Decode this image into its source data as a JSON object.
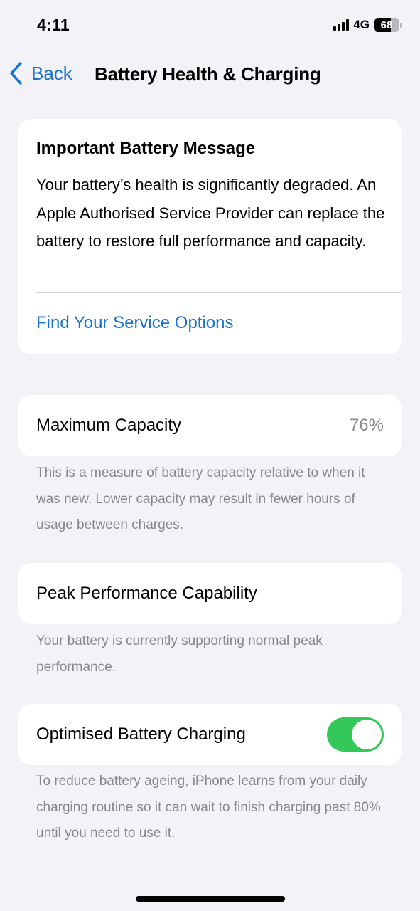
{
  "status_bar": {
    "time": "4:11",
    "network": "4G",
    "signal_bars": 4,
    "battery_level": "68",
    "battery_fraction": 0.68
  },
  "nav": {
    "back_label": "Back",
    "title": "Battery Health & Charging"
  },
  "battery_message": {
    "title": "Important Battery Message",
    "body": "Your battery’s health is significantly degraded. An Apple Authorised Service Provider can replace the battery to restore full performance and capacity.",
    "link": "Find Your Service Options"
  },
  "maximum_capacity": {
    "label": "Maximum Capacity",
    "value": "76%",
    "footnote": "This is a measure of battery capacity relative to when it was new. Lower capacity may result in fewer hours of usage between charges."
  },
  "peak_performance": {
    "label": "Peak Performance Capability",
    "footnote": "Your battery is currently supporting normal peak performance."
  },
  "optimised_charging": {
    "label": "Optimised Battery Charging",
    "enabled": true,
    "footnote": "To reduce battery ageing, iPhone learns from your daily charging routine so it can wait to finish charging past 80% until you need to use it."
  },
  "colors": {
    "accent": "#1a73d1",
    "toggle_on": "#34c759",
    "background": "#f2f2f7",
    "secondary_text": "#86868b"
  }
}
